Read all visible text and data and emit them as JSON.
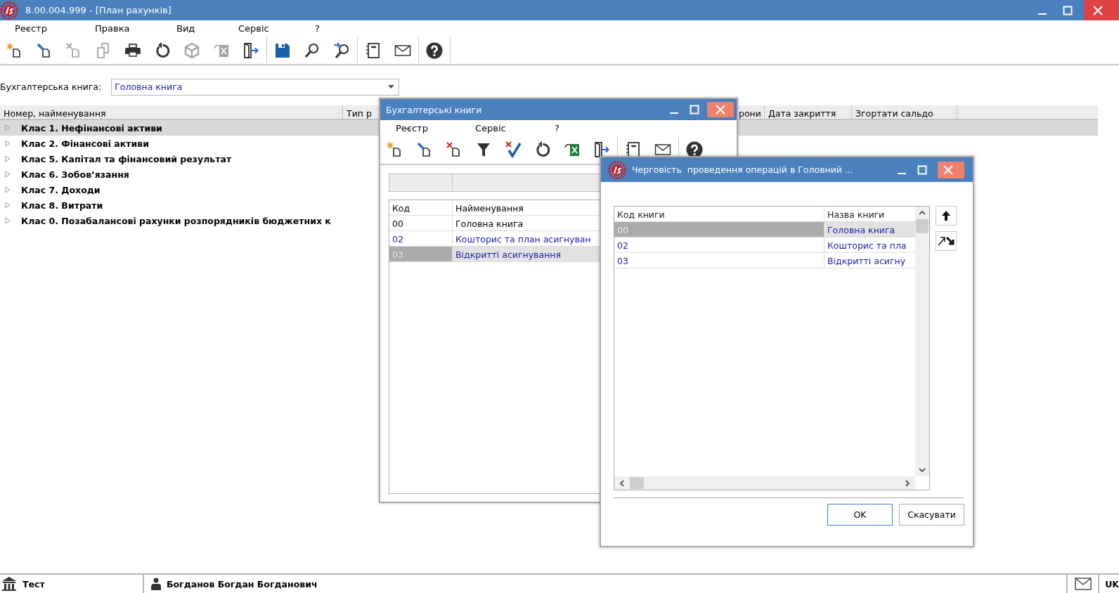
{
  "window": {
    "title": "8.00.004.999 - [План рахунків]"
  },
  "menu": [
    "Реєстр",
    "Правка",
    "Вид",
    "Сервіс",
    "?"
  ],
  "toolbar": [
    {
      "kind": "new",
      "disabled": false
    },
    {
      "kind": "edit",
      "disabled": false
    },
    {
      "kind": "delete",
      "disabled": true
    },
    {
      "kind": "copy",
      "disabled": true
    },
    {
      "kind": "print",
      "disabled": false
    },
    {
      "kind": "refresh",
      "disabled": false
    },
    {
      "kind": "cube",
      "disabled": true
    },
    {
      "kind": "excel",
      "disabled": true
    },
    {
      "kind": "exit",
      "disabled": false
    },
    {
      "kind": "separator"
    },
    {
      "kind": "save",
      "disabled": false
    },
    {
      "kind": "find",
      "disabled": false
    },
    {
      "kind": "findnext",
      "disabled": false
    },
    {
      "kind": "separator"
    },
    {
      "kind": "notebook",
      "disabled": false
    },
    {
      "kind": "mail",
      "disabled": false
    },
    {
      "kind": "separator"
    },
    {
      "kind": "help",
      "disabled": false
    },
    {
      "kind": "separator"
    }
  ],
  "book_field": {
    "label": "Бухгалтерська книга:",
    "value": "Головна книга"
  },
  "accounts_table": {
    "columns": [
      "Номер, найменування",
      "Тип р",
      "рони",
      "Дата закриття",
      "Згортати сальдо"
    ],
    "rows": [
      {
        "label": "Клас 1. Нефінансові активи",
        "expanded": false,
        "selected": true
      },
      {
        "label": "Клас 2. Фінансові активи",
        "expanded": false,
        "selected": false
      },
      {
        "label": "Клас 5. Капітал та фінансовий результат",
        "expanded": false,
        "selected": false
      },
      {
        "label": "Клас 6. Зобов’язання",
        "expanded": false,
        "selected": false
      },
      {
        "label": "Клас 7. Доходи",
        "expanded": false,
        "selected": false
      },
      {
        "label": "Клас 8. Витрати",
        "expanded": false,
        "selected": false
      },
      {
        "label": "Клас 0. Позабалансові рахунки розпорядників бюджетних к",
        "expanded": false,
        "selected": false
      }
    ]
  },
  "books_dialog": {
    "title": "Бухгалтерські книги",
    "menu": [
      "Реєстр",
      "Сервіс",
      "?"
    ],
    "toolbar": [
      {
        "kind": "new",
        "disabled": false
      },
      {
        "kind": "edit",
        "disabled": false
      },
      {
        "kind": "delete",
        "disabled": false
      },
      {
        "kind": "filter",
        "disabled": false
      },
      {
        "kind": "check",
        "disabled": false
      },
      {
        "kind": "refresh",
        "disabled": false
      },
      {
        "kind": "excel",
        "disabled": false
      },
      {
        "kind": "exit",
        "disabled": false
      },
      {
        "kind": "separator"
      },
      {
        "kind": "notebook",
        "disabled": false
      },
      {
        "kind": "mail",
        "disabled": false
      },
      {
        "kind": "separator"
      },
      {
        "kind": "help",
        "disabled": false
      }
    ],
    "columns": [
      "Код",
      "Найменування"
    ],
    "rows": [
      {
        "code": "00",
        "name": "Головна книга",
        "color": "#000000",
        "selected": false
      },
      {
        "code": "02",
        "name": "Кошторис та план асигнуван",
        "color": "#2323a8",
        "selected": false
      },
      {
        "code": "03",
        "name": "Відкритті асигнування",
        "color": "#2323a8",
        "selected": true
      }
    ]
  },
  "order_dialog": {
    "title": "Черговість  проведення операцій в Головний ...",
    "columns": [
      "Код книги",
      "Назва книги"
    ],
    "rows": [
      {
        "code": "00",
        "name": "Головна книга",
        "selected": true
      },
      {
        "code": "02",
        "name": "Кошторис та пла",
        "selected": false
      },
      {
        "code": "03",
        "name": "Відкритті асигну",
        "selected": false
      }
    ],
    "buttons": [
      "OK",
      "Скасувати"
    ]
  },
  "status_bar": {
    "organization": "Тест",
    "user": "Богданов Богдан Богданович",
    "language": "UK"
  }
}
